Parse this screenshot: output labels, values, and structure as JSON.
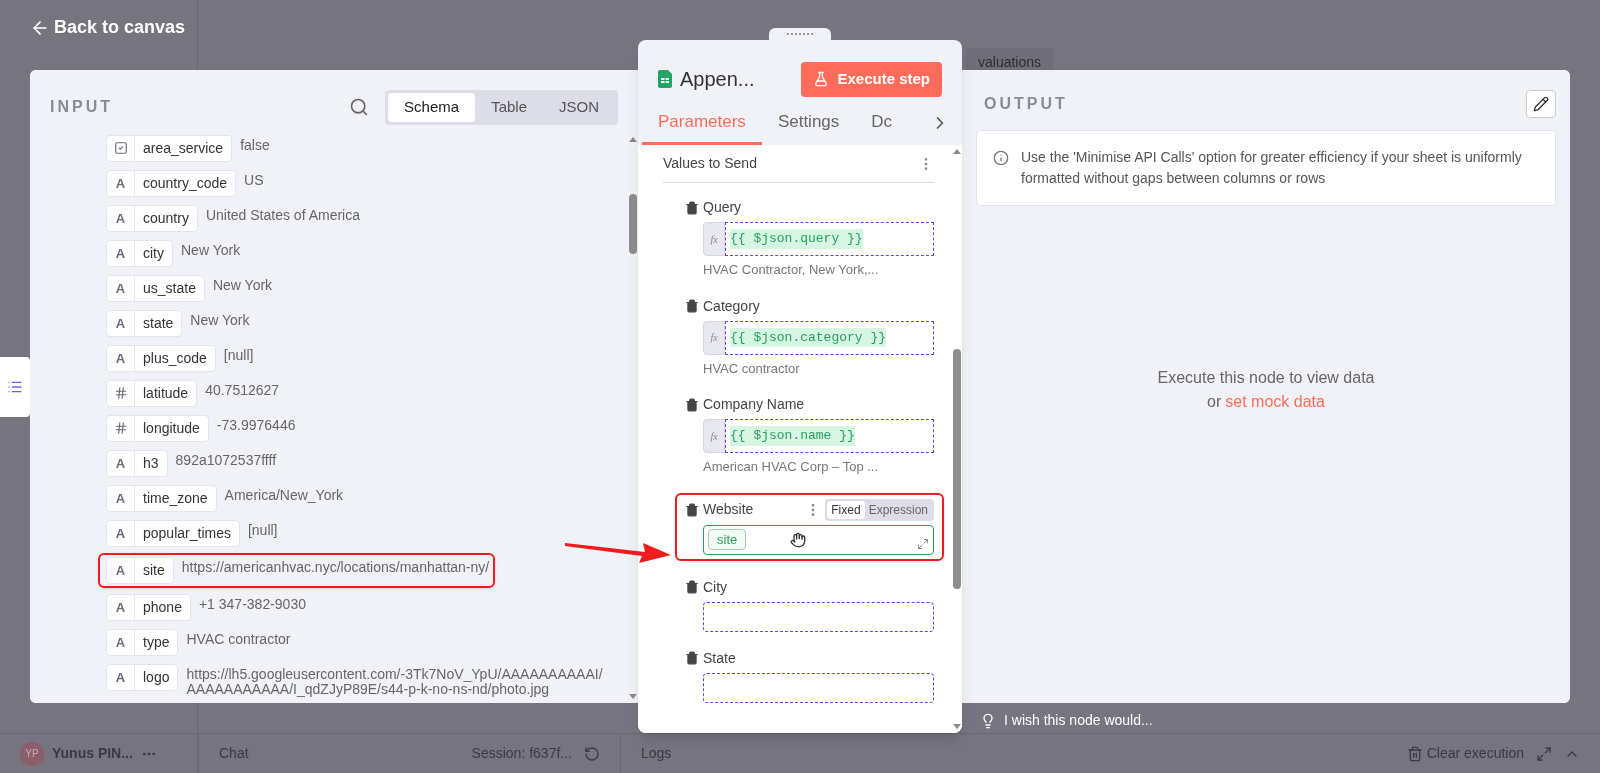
{
  "background": {
    "back_label": "Back to canvas",
    "tab_fragment": "valuations",
    "user_initials": "YP",
    "user_name": "Yunus PIN...",
    "chat_label": "Chat",
    "session": "Session: f637f...",
    "logs_label": "Logs",
    "clear_label": "Clear execution",
    "wish": "I wish this node would..."
  },
  "input": {
    "title": "INPUT",
    "views": [
      {
        "label": "Schema",
        "selected": true
      },
      {
        "label": "Table",
        "selected": false
      },
      {
        "label": "JSON",
        "selected": false
      }
    ],
    "fields": [
      {
        "kind": "boolean",
        "name": "area_service",
        "value": "false",
        "highlighted": false
      },
      {
        "kind": "string",
        "type_glyph": "A",
        "name": "country_code",
        "value": "US",
        "highlighted": false
      },
      {
        "kind": "string",
        "type_glyph": "A",
        "name": "country",
        "value": "United States of America",
        "highlighted": false
      },
      {
        "kind": "string",
        "type_glyph": "A",
        "name": "city",
        "value": "New York",
        "highlighted": false
      },
      {
        "kind": "string",
        "type_glyph": "A",
        "name": "us_state",
        "value": "New York",
        "highlighted": false
      },
      {
        "kind": "string",
        "type_glyph": "A",
        "name": "state",
        "value": "New York",
        "highlighted": false
      },
      {
        "kind": "string",
        "type_glyph": "A",
        "name": "plus_code",
        "value": "[null]",
        "highlighted": false
      },
      {
        "kind": "number",
        "name": "latitude",
        "value": "40.7512627",
        "highlighted": false
      },
      {
        "kind": "number",
        "name": "longitude",
        "value": "-73.9976446",
        "highlighted": false
      },
      {
        "kind": "string",
        "type_glyph": "A",
        "name": "h3",
        "value": "892a1072537ffff",
        "highlighted": false
      },
      {
        "kind": "string",
        "type_glyph": "A",
        "name": "time_zone",
        "value": "America/New_York",
        "highlighted": false
      },
      {
        "kind": "string",
        "type_glyph": "A",
        "name": "popular_times",
        "value": "[null]",
        "highlighted": false
      },
      {
        "kind": "string",
        "type_glyph": "A",
        "name": "site",
        "value": "https://americanhvac.nyc/locations/manhattan-ny/",
        "highlighted": true
      },
      {
        "kind": "string",
        "type_glyph": "A",
        "name": "phone",
        "value": "+1 347-382-9030",
        "highlighted": false
      },
      {
        "kind": "string",
        "type_glyph": "A",
        "name": "type",
        "value": "HVAC contractor",
        "highlighted": false
      },
      {
        "kind": "string",
        "type_glyph": "A",
        "name": "logo",
        "value": "https://lh5.googleusercontent.com/-3Tk7NoV_YpU/AAAAAAAAAAI/AAAAAAAAAAA/I_qdZJyP89E/s44-p-k-no-ns-nd/photo.jpg",
        "highlighted": false
      }
    ]
  },
  "node": {
    "title": "Appen...",
    "execute_label": "Execute step",
    "tabs": [
      {
        "label": "Parameters",
        "selected": true
      },
      {
        "label": "Settings",
        "selected": false
      },
      {
        "label": "Dc",
        "selected": false
      }
    ],
    "section_title": "Values to Send",
    "params": [
      {
        "kind": "expression",
        "label": "Query",
        "fx": "fx",
        "expression": "{{ $json.query }}",
        "preview": "HVAC Contractor, New York,...",
        "highlighted": false
      },
      {
        "kind": "expression",
        "label": "Category",
        "fx": "fx",
        "expression": "{{ $json.category }}",
        "preview": "HVAC contractor",
        "highlighted": false
      },
      {
        "kind": "expression",
        "label": "Company Name",
        "fx": "fx",
        "expression": "{{ $json.name }}",
        "preview": "American HVAC Corp – Top ...",
        "highlighted": false
      },
      {
        "kind": "fixed",
        "label": "Website",
        "chip": "site",
        "modes": [
          {
            "label": "Fixed",
            "selected": true
          },
          {
            "label": "Expression",
            "selected": false
          }
        ],
        "highlighted": true
      },
      {
        "kind": "empty",
        "label": "City",
        "highlighted": false
      },
      {
        "kind": "empty",
        "label": "State",
        "highlighted": false
      }
    ]
  },
  "output": {
    "title": "OUTPUT",
    "notice": "Use the 'Minimise API Calls' option for greater efficiency if your sheet is uniformly formatted without gaps between columns or rows",
    "empty_text": "Execute this node to view data",
    "or_text": "or",
    "mock_link": "set mock data"
  }
}
